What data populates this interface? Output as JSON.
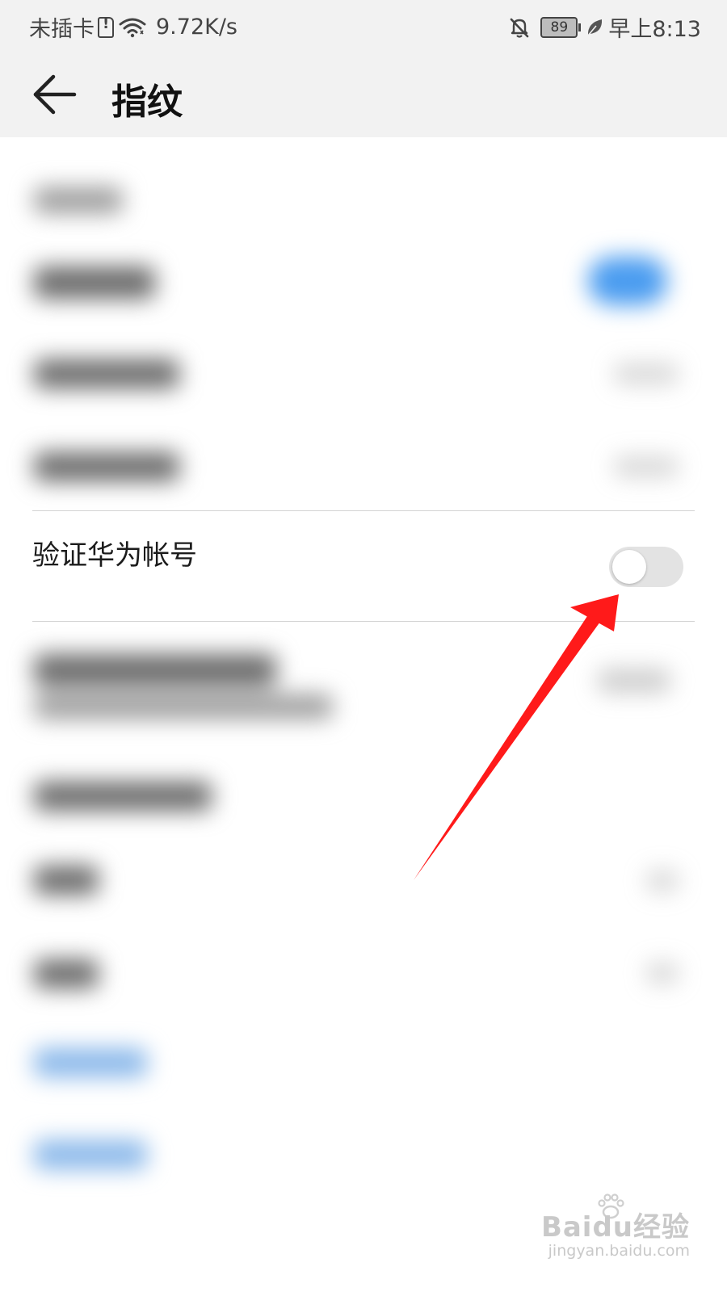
{
  "status_bar": {
    "carrier": "未插卡",
    "net_speed": "9.72K/s",
    "battery": "89",
    "time": "早上8:13",
    "icons": [
      "sim-alert-icon",
      "wifi-icon",
      "bell-off-icon",
      "battery-icon",
      "leaf-icon"
    ]
  },
  "header": {
    "back_icon": "arrow-left-icon",
    "title": "指纹"
  },
  "settings": {
    "verify_account": {
      "label": "验证华为帐号",
      "toggle_on": false
    }
  },
  "annotation": {
    "arrow_color": "#ff1a1a",
    "points_to": "toggle"
  },
  "watermark": {
    "brand": "Baidu经验",
    "url": "jingyan.baidu.com"
  },
  "colors": {
    "header_bg": "#f2f2f2",
    "page_bg": "#ffffff",
    "toggle_off": "#e3e3e3",
    "accent_blue": "#4a9cf0"
  }
}
